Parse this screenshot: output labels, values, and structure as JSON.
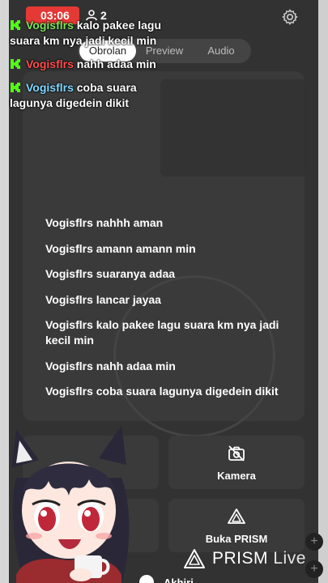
{
  "status": {
    "live_time": "03:06",
    "viewer_count": "2",
    "top_title": "lancar jayaa"
  },
  "tabs": [
    {
      "label": "Obrolan",
      "active": true
    },
    {
      "label": "Preview",
      "active": false
    },
    {
      "label": "Audio",
      "active": false
    }
  ],
  "overlay_chat": [
    {
      "user": "Vogisflrs",
      "message": "kalo pakee lagu suara km nya jadi kecil min",
      "user_color": "green"
    },
    {
      "user": "Vogisflrs",
      "message": "nahh adaa min",
      "user_color": "red"
    },
    {
      "user": "Vogisflrs",
      "message": "coba suara lagunya digedein dikit",
      "user_color": "blue"
    }
  ],
  "chat": [
    "Vogisflrs nahhh aman",
    "Vogisflrs amann amann min",
    "Vogisflrs suaranya adaa",
    "Vogisflrs lancar jayaa",
    "Vogisflrs kalo pakee lagu suara km nya jadi kecil min",
    "Vogisflrs nahh adaa min",
    "Vogisflrs coba suara lagunya digedein dikit"
  ],
  "buttons": {
    "camera_label": "Kamera",
    "open_prism_label": "Buka PRISM",
    "end_label": "Akhiri"
  },
  "brand": {
    "prism": "PRISM",
    "live": "Live"
  },
  "icons": {
    "gear": "gear-icon",
    "viewer": "person-icon",
    "camera_off": "camera-off-icon",
    "prism": "prism-icon",
    "chat_badge": "k-badge-icon"
  },
  "colors": {
    "live_red": "#e53935",
    "accent_green": "#53fc18"
  }
}
